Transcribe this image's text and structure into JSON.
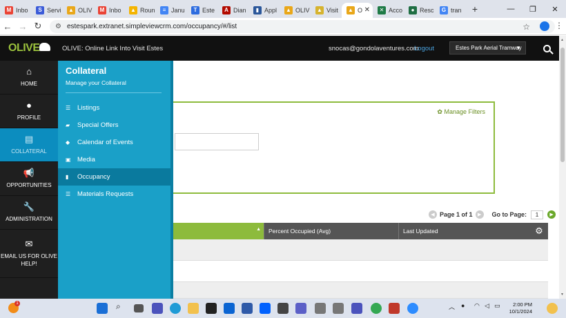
{
  "browser": {
    "tabs": [
      {
        "label": "Inbo",
        "icon": "gmail-icon",
        "color": "#ea4335",
        "glyph": "M"
      },
      {
        "label": "Servi",
        "icon": "service-icon",
        "color": "#3b5bd8",
        "glyph": "S"
      },
      {
        "label": "OLIV",
        "icon": "olive-icon",
        "color": "#e9a719",
        "glyph": "▲"
      },
      {
        "label": "Inbo",
        "icon": "gmail-icon",
        "color": "#ea4335",
        "glyph": "M"
      },
      {
        "label": "Roun",
        "icon": "drive-icon",
        "color": "#f4b400",
        "glyph": "▲"
      },
      {
        "label": "Janu",
        "icon": "docs-icon",
        "color": "#4285f4",
        "glyph": "≡"
      },
      {
        "label": "Este",
        "icon": "board-icon",
        "color": "#2d6cdf",
        "glyph": "T"
      },
      {
        "label": "Dian",
        "icon": "pdf-icon",
        "color": "#b30b00",
        "glyph": "A"
      },
      {
        "label": "Appl",
        "icon": "doc-icon",
        "color": "#2b579a",
        "glyph": "▮"
      },
      {
        "label": "OLIV",
        "icon": "olive-icon",
        "color": "#e9a719",
        "glyph": "▲"
      },
      {
        "label": "Visit",
        "icon": "visit-icon",
        "color": "#d6b32e",
        "glyph": "▲"
      },
      {
        "label": "O",
        "icon": "olive-icon",
        "color": "#e9a719",
        "glyph": "▲",
        "active": true
      },
      {
        "label": "Acco",
        "icon": "acct-icon",
        "color": "#1e7a46",
        "glyph": "✕"
      },
      {
        "label": "Resc",
        "icon": "resc-icon",
        "color": "#1f6e43",
        "glyph": "●"
      },
      {
        "label": "tran",
        "icon": "google-icon",
        "color": "#4285f4",
        "glyph": "G"
      }
    ],
    "new_tab": "+",
    "url": "estespark.extranet.simpleviewcrm.com/occupancy/#/list"
  },
  "header": {
    "logo_text": "OLIVE",
    "title": "OLIVE: Online Link Into Visit Estes",
    "user_email": "snocas@gondolaventures.com",
    "logout_label": "Logout",
    "account_selected": "Estes Park Aerial Tramway"
  },
  "leftnav": [
    {
      "label": "HOME",
      "icon": "home-icon",
      "glyph": "⌂"
    },
    {
      "label": "PROFILE",
      "icon": "profile-icon",
      "glyph": "●"
    },
    {
      "label": "COLLATERAL",
      "icon": "collateral-icon",
      "glyph": "▤",
      "active": true
    },
    {
      "label": "OPPORTUNITIES",
      "icon": "megaphone-icon",
      "glyph": "📢"
    },
    {
      "label": "ADMINISTRATION",
      "icon": "wrench-icon",
      "glyph": "🔧"
    },
    {
      "label": "EMAIL US FOR OLIVE HELP!",
      "icon": "envelope-icon",
      "glyph": "✉"
    }
  ],
  "flyout": {
    "title": "Collateral",
    "subtitle": "Manage your Collateral",
    "items": [
      {
        "label": "Listings",
        "icon": "list-icon",
        "glyph": "☰"
      },
      {
        "label": "Special Offers",
        "icon": "ticket-icon",
        "glyph": "▰"
      },
      {
        "label": "Calendar of Events",
        "icon": "tag-icon",
        "glyph": "◆"
      },
      {
        "label": "Media",
        "icon": "media-icon",
        "glyph": "▣"
      },
      {
        "label": "Occupancy",
        "icon": "occupancy-icon",
        "glyph": "▮",
        "active": true
      },
      {
        "label": "Materials Requests",
        "icon": "list-icon",
        "glyph": "☰"
      }
    ]
  },
  "main": {
    "manage_filters": "Manage Filters",
    "pager": {
      "page_label": "Page 1 of 1",
      "goto_label": "Go to Page:",
      "page_value": "1"
    },
    "columns": [
      "Percent Occupied (Avg)",
      "Last Updated"
    ]
  },
  "taskbar": {
    "time": "2:00 PM",
    "date": "10/1/2024",
    "weather_badge": "1"
  }
}
